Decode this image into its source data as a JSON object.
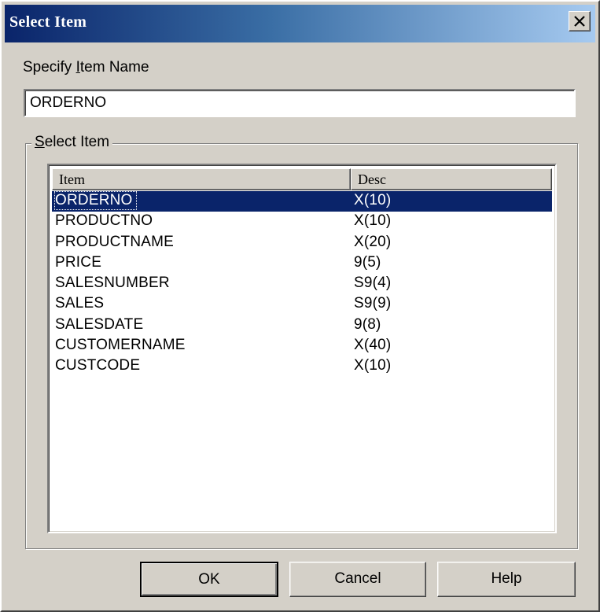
{
  "window": {
    "title": "Select Item",
    "close_glyph": "×"
  },
  "specify": {
    "label": "Specify Item Name",
    "value": "ORDERNO"
  },
  "group": {
    "label": "Select Item"
  },
  "list": {
    "columns": [
      "Item",
      "Desc"
    ],
    "rows": [
      {
        "item": "ORDERNO",
        "desc": "X(10)"
      },
      {
        "item": "PRODUCTNO",
        "desc": "X(10)"
      },
      {
        "item": "PRODUCTNAME",
        "desc": "X(20)"
      },
      {
        "item": "PRICE",
        "desc": "9(5)"
      },
      {
        "item": "SALESNUMBER",
        "desc": "S9(4)"
      },
      {
        "item": "SALES",
        "desc": "S9(9)"
      },
      {
        "item": "SALESDATE",
        "desc": "9(8)"
      },
      {
        "item": "CUSTOMERNAME",
        "desc": "X(40)"
      },
      {
        "item": "CUSTCODE",
        "desc": "X(10)"
      }
    ],
    "selected_index": 0
  },
  "buttons": {
    "ok": "OK",
    "cancel": "Cancel",
    "help": "Help"
  },
  "colors": {
    "title_start": "#0a246a",
    "title_end": "#a6caf0",
    "face": "#d4d0c8",
    "selection": "#0a246a"
  }
}
